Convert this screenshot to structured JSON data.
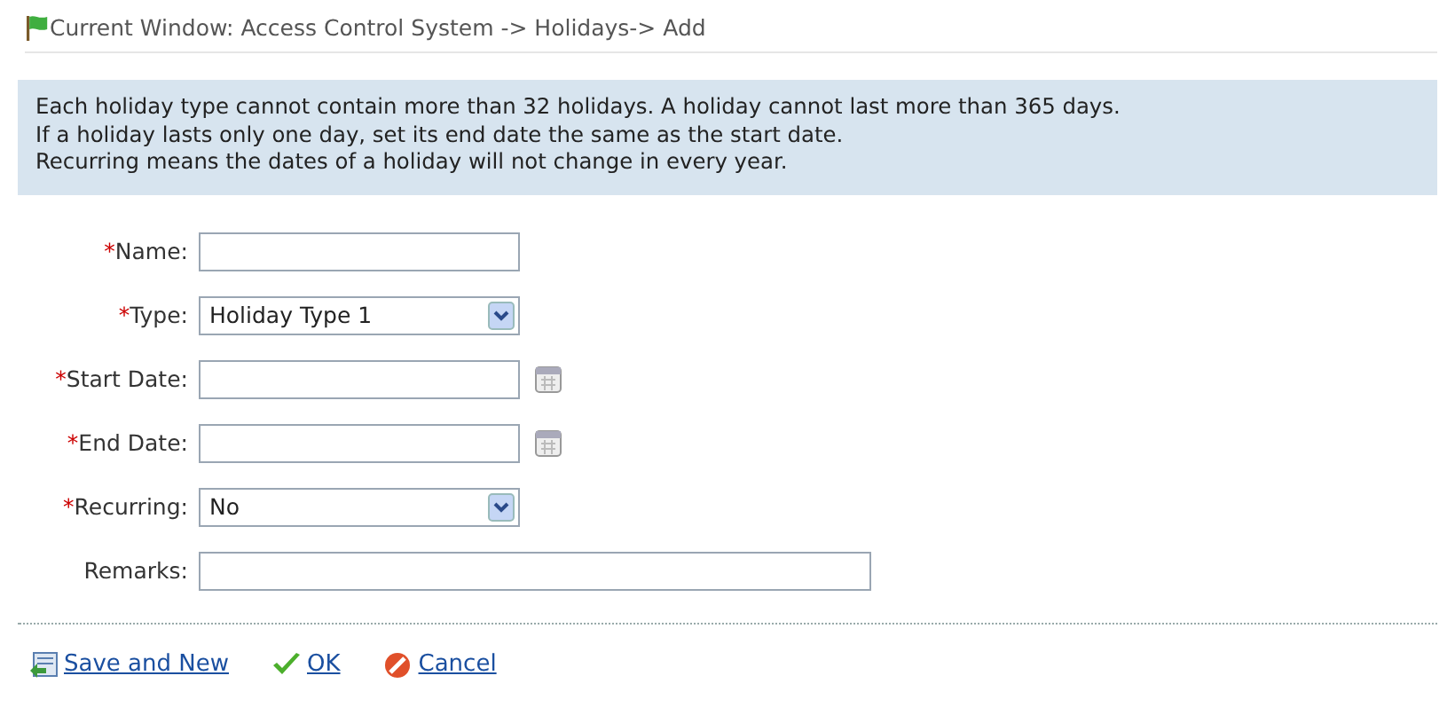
{
  "breadcrumb": "Current Window: Access Control System -> Holidays-> Add",
  "info": "Each holiday type cannot contain more than 32 holidays. A holiday cannot last more than 365 days.\nIf a holiday lasts only one day, set its end date the same as the start date.\nRecurring means the dates of a holiday will not change in every year.",
  "fields": [
    {
      "kind": "text",
      "required_mark": "*",
      "label": "Name:"
    },
    {
      "kind": "select",
      "required_mark": "*",
      "label": "Type:",
      "value": "Holiday Type 1"
    },
    {
      "kind": "date",
      "required_mark": "*",
      "label": "Start Date:"
    },
    {
      "kind": "date",
      "required_mark": "*",
      "label": "End Date:"
    },
    {
      "kind": "select",
      "required_mark": "*",
      "label": "Recurring:",
      "value": "No"
    },
    {
      "kind": "wide",
      "label": "Remarks:"
    }
  ],
  "actions": [
    {
      "kind": "save-new",
      "label": "Save and New"
    },
    {
      "kind": "ok",
      "label": "OK"
    },
    {
      "kind": "cancel",
      "label": "Cancel"
    }
  ]
}
